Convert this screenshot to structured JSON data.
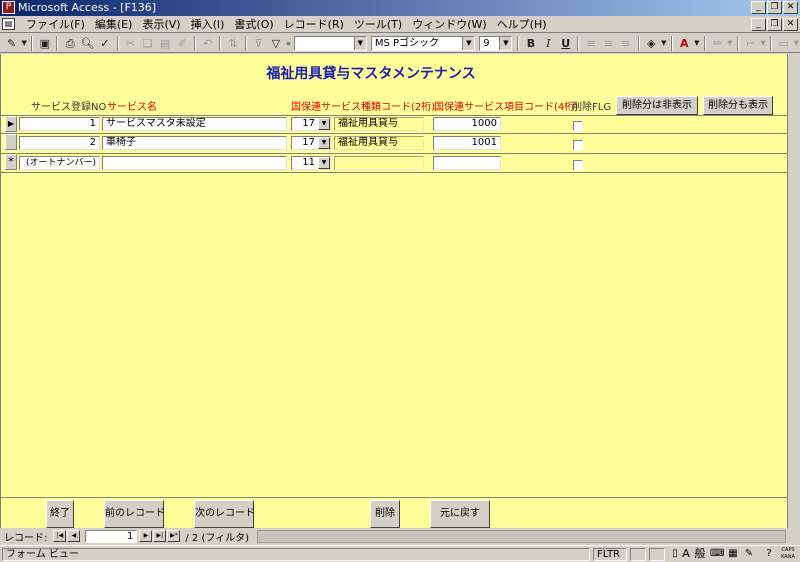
{
  "window": {
    "title": "Microsoft Access - [F136]",
    "icon": "access-key-icon"
  },
  "menu": {
    "items": [
      "ファイル(F)",
      "編集(E)",
      "表示(V)",
      "挿入(I)",
      "書式(O)",
      "レコード(R)",
      "ツール(T)",
      "ウィンドウ(W)",
      "ヘルプ(H)"
    ]
  },
  "toolbar": {
    "font_name": "MS Pゴシック",
    "font_size": "9",
    "bold": "B",
    "italic": "I",
    "underline": "U"
  },
  "form": {
    "title": "福祉用具貸与マスタメンテナンス",
    "headers": {
      "service_no": "サービス登録NO",
      "service_name": "サービス名",
      "kind_code": "国保連サービス種類コード(2桁)",
      "item_code": "国保連サービス項目コード(4桁)",
      "delete_flg": "削除FLG"
    },
    "buttons": {
      "hide_deleted": "削除分は非表示",
      "show_deleted": "削除分も表示"
    },
    "rows": [
      {
        "no": "1",
        "name": "サービスマスタ未設定",
        "kind": "17",
        "kind_name": "福祉用具貸与",
        "item": "1000"
      },
      {
        "no": "2",
        "name": "車椅子",
        "kind": "17",
        "kind_name": "福祉用具貸与",
        "item": "1001"
      }
    ],
    "new_row": {
      "marker": "*",
      "no": "(オートナンバー)",
      "kind": "11"
    },
    "current_marker": "▶",
    "footer_buttons": {
      "end": "終了",
      "prev": "前のレコード",
      "next": "次のレコード",
      "delete": "削除",
      "undo": "元に戻す"
    }
  },
  "nav": {
    "label": "レコード:",
    "current": "1",
    "total": "/ 2 (フィルタ)"
  },
  "status": {
    "view": "フォーム ビュー",
    "filter": "FLTR",
    "ime_mode": "般",
    "caps": "CAPS",
    "kana": "KANA"
  }
}
